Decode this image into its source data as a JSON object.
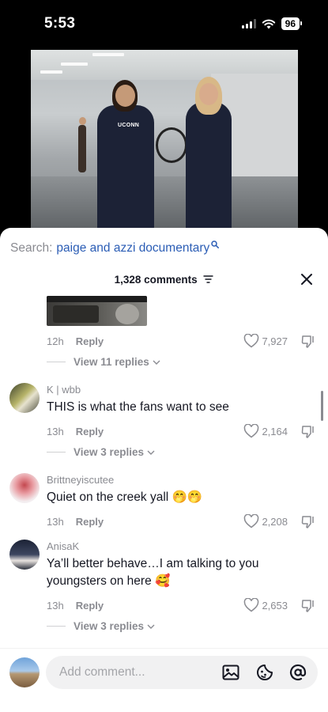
{
  "status_bar": {
    "time": "5:53",
    "battery": "96"
  },
  "video": {
    "jersey_text": "UCONN"
  },
  "search": {
    "label": "Search:",
    "query": "paige and azzi documentary"
  },
  "comments_header": {
    "count_label": "1,328 comments"
  },
  "top_comment": {
    "time": "12h",
    "reply_label": "Reply",
    "likes": "7,927",
    "view_replies": "View 11 replies"
  },
  "comments": [
    {
      "username": "K | wbb",
      "text": "THIS is what the fans want to see",
      "time": "13h",
      "reply_label": "Reply",
      "likes": "2,164",
      "view_replies": "View 3 replies"
    },
    {
      "username": "Brittneyiscutee",
      "text": "Quiet on the creek yall 🤭🤭",
      "time": "13h",
      "reply_label": "Reply",
      "likes": "2,208",
      "view_replies": ""
    },
    {
      "username": "AnisaK",
      "text": "Ya’ll better behave…I am talking to you youngsters on here 🥰",
      "time": "13h",
      "reply_label": "Reply",
      "likes": "2,653",
      "view_replies": "View 3 replies"
    }
  ],
  "composer": {
    "placeholder": "Add comment..."
  },
  "icons": {
    "like": "heart-outline-icon",
    "dislike": "thumbs-down-icon",
    "sort": "sort-lines-icon",
    "close": "close-icon",
    "image": "image-icon",
    "emoji": "emoji-icon",
    "mention": "at-mention-icon"
  },
  "colors": {
    "accent_link": "#2b5db5",
    "muted": "#8a8b91",
    "text": "#161823"
  }
}
